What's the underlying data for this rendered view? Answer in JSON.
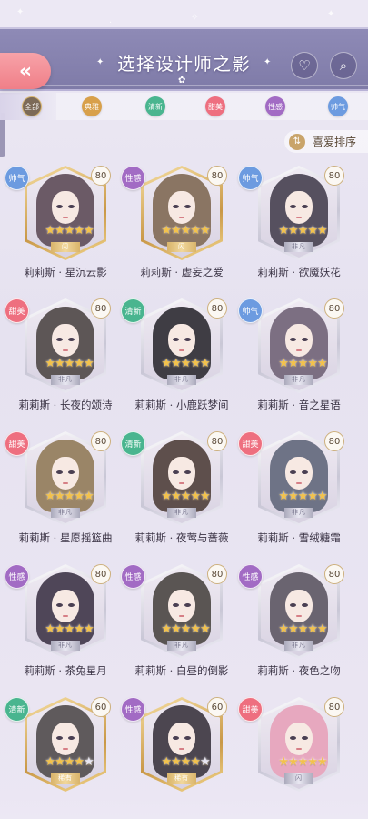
{
  "header": {
    "title": "选择设计师之影",
    "back_icon": "«",
    "favorite_icon": "♡",
    "search_icon": "⌕",
    "deco_left": "✦",
    "deco_right": "✦",
    "deco_flower": "✿"
  },
  "filters": [
    {
      "label": "全部",
      "color": "#7c6a58",
      "selected": true
    },
    {
      "label": "典雅",
      "color": "#d8a04a"
    },
    {
      "label": "清新",
      "color": "#49b58f"
    },
    {
      "label": "甜美",
      "color": "#ee6f7f"
    },
    {
      "label": "性感",
      "color": "#a26bc4"
    },
    {
      "label": "帅气",
      "color": "#6c9be0"
    }
  ],
  "sort": {
    "label": "喜爱排序",
    "icon": "⇅"
  },
  "type_colors": {
    "帅气": "#6c9be0",
    "性感": "#a26bc4",
    "甜美": "#ee6f7f",
    "清新": "#49b58f"
  },
  "cards": [
    {
      "name": "莉莉斯 · 星沉云影",
      "type": "帅气",
      "level": "80",
      "stars": 5,
      "frame": "gold",
      "banner": "闪",
      "hair": "#6b5a66"
    },
    {
      "name": "莉莉斯 · 虚妄之爱",
      "type": "性感",
      "level": "80",
      "stars": 5,
      "frame": "gold",
      "banner": "闪",
      "hair": "#8a7563"
    },
    {
      "name": "莉莉斯 · 欲魇妖花",
      "type": "帅气",
      "level": "80",
      "stars": 5,
      "frame": "silver",
      "banner": "非凡",
      "hair": "#56505f"
    },
    {
      "name": "莉莉斯 · 长夜的颂诗",
      "type": "甜美",
      "level": "80",
      "stars": 5,
      "frame": "silver",
      "banner": "非凡",
      "hair": "#5d5656"
    },
    {
      "name": "莉莉斯 · 小鹿跃梦间",
      "type": "清新",
      "level": "80",
      "stars": 5,
      "frame": "silver",
      "banner": "非凡",
      "hair": "#3f3d44"
    },
    {
      "name": "莉莉斯 · 音之星语",
      "type": "帅气",
      "level": "80",
      "stars": 5,
      "frame": "silver",
      "banner": "非凡",
      "hair": "#7c6f82"
    },
    {
      "name": "莉莉斯 · 星愿摇篮曲",
      "type": "甜美",
      "level": "80",
      "stars": 5,
      "frame": "silver",
      "banner": "非凡",
      "hair": "#9a8567"
    },
    {
      "name": "莉莉斯 · 夜莺与蔷薇",
      "type": "清新",
      "level": "80",
      "stars": 5,
      "frame": "silver",
      "banner": "非凡",
      "hair": "#5e4f4c"
    },
    {
      "name": "莉莉斯 · 雪绒糖霜",
      "type": "甜美",
      "level": "80",
      "stars": 5,
      "frame": "silver",
      "banner": "非凡",
      "hair": "#6e7386"
    },
    {
      "name": "莉莉斯 · 茶兔星月",
      "type": "性感",
      "level": "80",
      "stars": 5,
      "frame": "silver",
      "banner": "非凡",
      "hair": "#4f4658"
    },
    {
      "name": "莉莉斯 · 白昼的倒影",
      "type": "性感",
      "level": "80",
      "stars": 5,
      "frame": "silver",
      "banner": "非凡",
      "hair": "#5a5553"
    },
    {
      "name": "莉莉斯 · 夜色之吻",
      "type": "性感",
      "level": "80",
      "stars": 5,
      "frame": "silver",
      "banner": "非凡",
      "hair": "#6a6470"
    },
    {
      "name": "",
      "type": "清新",
      "level": "60",
      "stars": 4,
      "frame": "gold",
      "banner": "稀有",
      "hair": "#5f5a5c"
    },
    {
      "name": "",
      "type": "性感",
      "level": "60",
      "stars": 4,
      "frame": "gold",
      "banner": "稀有",
      "hair": "#4c4650"
    },
    {
      "name": "",
      "type": "甜美",
      "level": "80",
      "stars": 5,
      "frame": "silver",
      "banner": "闪",
      "hair": "#e7a8bf"
    }
  ]
}
